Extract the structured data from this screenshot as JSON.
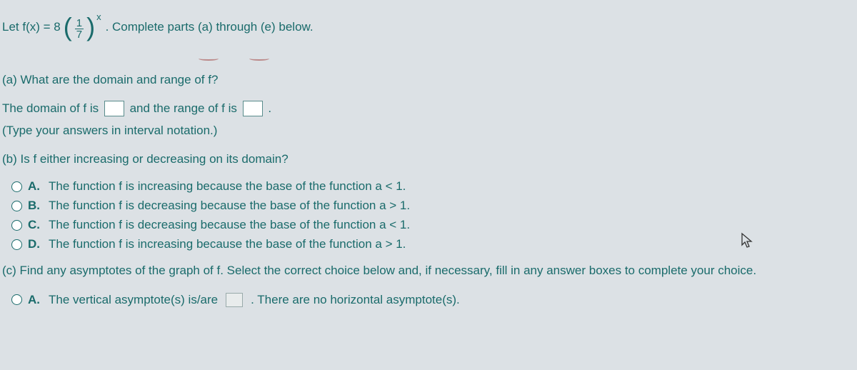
{
  "intro": {
    "prefix": "Let f(x) = 8",
    "frac_top": "1",
    "frac_bot": "7",
    "exp": "x",
    "suffix": ". Complete parts (a) through (e) below."
  },
  "partA": {
    "prompt": "(a) What are the domain and range of f?",
    "answer_prefix": "The domain of f is ",
    "answer_mid": " and the range of f is ",
    "answer_suffix": ".",
    "hint": "(Type your answers in interval notation.)"
  },
  "partB": {
    "prompt": "(b) Is f either increasing or decreasing on its domain?",
    "options": [
      {
        "label": "A.",
        "text": "The function f is increasing because the base of the function a < 1."
      },
      {
        "label": "B.",
        "text": "The function f is decreasing because the base of the function a > 1."
      },
      {
        "label": "C.",
        "text": "The function f is decreasing because the base of the function a < 1."
      },
      {
        "label": "D.",
        "text": "The function f is increasing because the base of the function a > 1."
      }
    ]
  },
  "partC": {
    "prompt": "(c) Find any asymptotes of the graph of f. Select the correct choice below and, if necessary, fill in any answer boxes to complete your choice.",
    "optA_label": "A.",
    "optA_prefix": "The vertical asymptote(s) is/are ",
    "optA_suffix": ". There are no horizontal asymptote(s)."
  }
}
